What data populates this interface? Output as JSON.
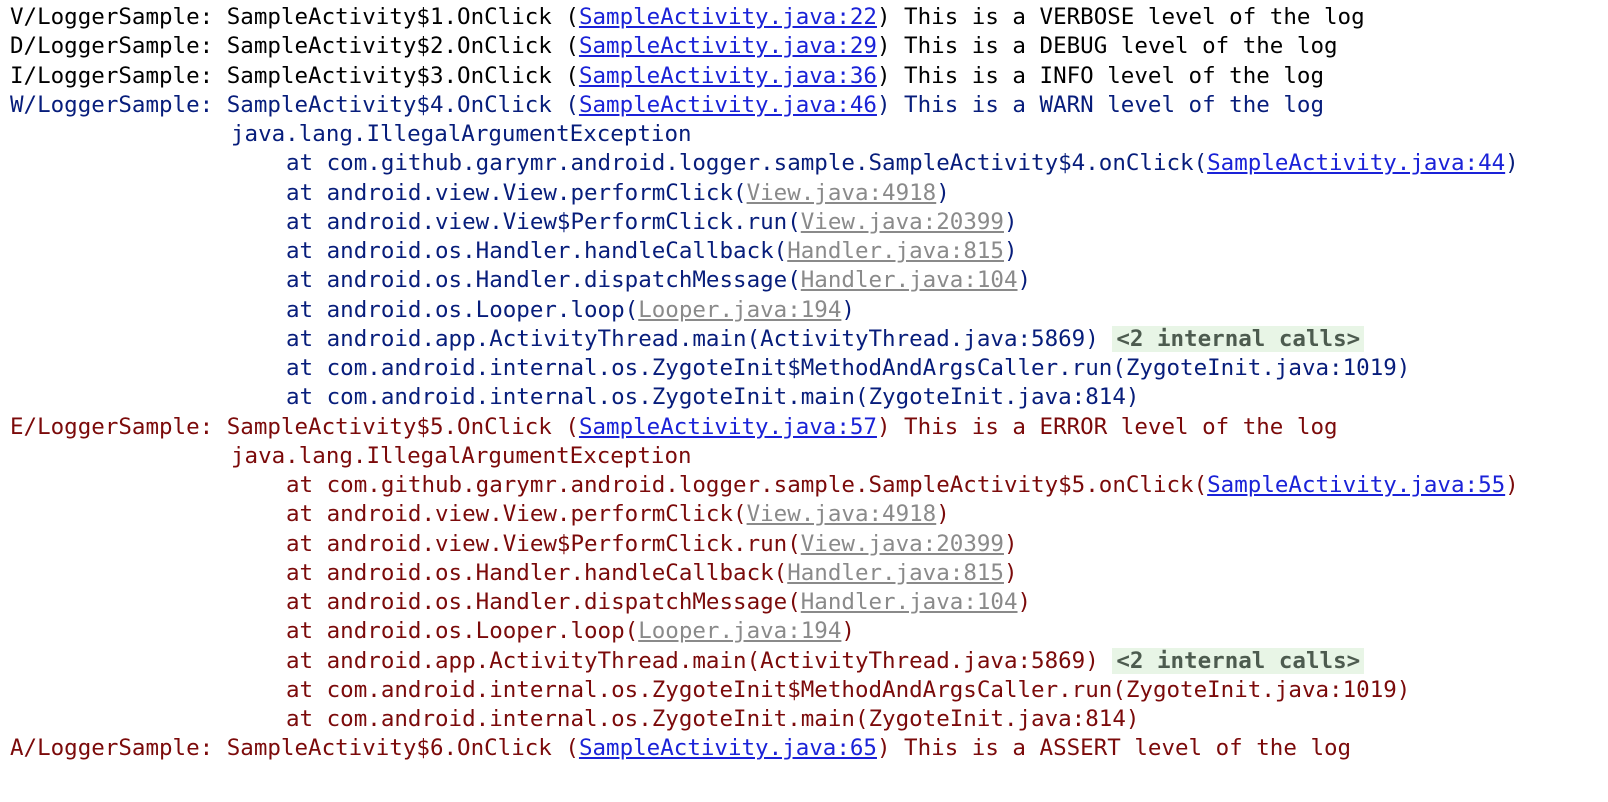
{
  "colors": {
    "default": "#000000",
    "warn": "#071d7b",
    "error": "#7b0a0a",
    "source_link": "#1a22d8",
    "library_link": "#8a8a8a",
    "fold_bg": "#e8f5e6"
  },
  "lines": [
    {
      "type": "log",
      "level": "V",
      "tag": "V/LoggerSample: ",
      "method": "SampleActivity$1.OnClick (",
      "link": "SampleActivity.java:22",
      "message": ") This is a VERBOSE level of the log"
    },
    {
      "type": "log",
      "level": "D",
      "tag": "D/LoggerSample: ",
      "method": "SampleActivity$2.OnClick (",
      "link": "SampleActivity.java:29",
      "message": ") This is a DEBUG level of the log"
    },
    {
      "type": "log",
      "level": "I",
      "tag": "I/LoggerSample: ",
      "method": "SampleActivity$3.OnClick (",
      "link": "SampleActivity.java:36",
      "message": ") This is a INFO level of the log"
    },
    {
      "type": "log",
      "level": "W",
      "tag": "W/LoggerSample: ",
      "method": "SampleActivity$4.OnClick (",
      "link": "SampleActivity.java:46",
      "message": ") This is a WARN level of the log"
    },
    {
      "type": "exception",
      "level": "W",
      "text": "java.lang.IllegalArgumentException"
    },
    {
      "type": "frame",
      "level": "W",
      "prefix": "at com.github.garymr.android.logger.sample.SampleActivity$4.onClick(",
      "link": "SampleActivity.java:44",
      "link_kind": "src",
      "suffix": ")"
    },
    {
      "type": "frame",
      "level": "W",
      "prefix": "at android.view.View.performClick(",
      "link": "View.java:4918",
      "link_kind": "lib",
      "suffix": ")"
    },
    {
      "type": "frame",
      "level": "W",
      "prefix": "at android.view.View$PerformClick.run(",
      "link": "View.java:20399",
      "link_kind": "lib",
      "suffix": ")"
    },
    {
      "type": "frame",
      "level": "W",
      "prefix": "at android.os.Handler.handleCallback(",
      "link": "Handler.java:815",
      "link_kind": "lib",
      "suffix": ")"
    },
    {
      "type": "frame",
      "level": "W",
      "prefix": "at android.os.Handler.dispatchMessage(",
      "link": "Handler.java:104",
      "link_kind": "lib",
      "suffix": ")"
    },
    {
      "type": "frame",
      "level": "W",
      "prefix": "at android.os.Looper.loop(",
      "link": "Looper.java:194",
      "link_kind": "lib",
      "suffix": ")"
    },
    {
      "type": "frame",
      "level": "W",
      "prefix": "at android.app.ActivityThread.main(ActivityThread.java:5869)",
      "fold": "<2 internal calls>"
    },
    {
      "type": "frame",
      "level": "W",
      "prefix": "at com.android.internal.os.ZygoteInit$MethodAndArgsCaller.run(ZygoteInit.java:1019)"
    },
    {
      "type": "frame",
      "level": "W",
      "prefix": "at com.android.internal.os.ZygoteInit.main(ZygoteInit.java:814)"
    },
    {
      "type": "log",
      "level": "E",
      "tag": "E/LoggerSample: ",
      "method": "SampleActivity$5.OnClick (",
      "link": "SampleActivity.java:57",
      "message": ") This is a ERROR level of the log"
    },
    {
      "type": "exception",
      "level": "E",
      "text": "java.lang.IllegalArgumentException"
    },
    {
      "type": "frame",
      "level": "E",
      "prefix": "at com.github.garymr.android.logger.sample.SampleActivity$5.onClick(",
      "link": "SampleActivity.java:55",
      "link_kind": "src",
      "suffix": ")"
    },
    {
      "type": "frame",
      "level": "E",
      "prefix": "at android.view.View.performClick(",
      "link": "View.java:4918",
      "link_kind": "lib",
      "suffix": ")"
    },
    {
      "type": "frame",
      "level": "E",
      "prefix": "at android.view.View$PerformClick.run(",
      "link": "View.java:20399",
      "link_kind": "lib",
      "suffix": ")"
    },
    {
      "type": "frame",
      "level": "E",
      "prefix": "at android.os.Handler.handleCallback(",
      "link": "Handler.java:815",
      "link_kind": "lib",
      "suffix": ")"
    },
    {
      "type": "frame",
      "level": "E",
      "prefix": "at android.os.Handler.dispatchMessage(",
      "link": "Handler.java:104",
      "link_kind": "lib",
      "suffix": ")"
    },
    {
      "type": "frame",
      "level": "E",
      "prefix": "at android.os.Looper.loop(",
      "link": "Looper.java:194",
      "link_kind": "lib",
      "suffix": ")"
    },
    {
      "type": "frame",
      "level": "E",
      "prefix": "at android.app.ActivityThread.main(ActivityThread.java:5869)",
      "fold": "<2 internal calls>"
    },
    {
      "type": "frame",
      "level": "E",
      "prefix": "at com.android.internal.os.ZygoteInit$MethodAndArgsCaller.run(ZygoteInit.java:1019)"
    },
    {
      "type": "frame",
      "level": "E",
      "prefix": "at com.android.internal.os.ZygoteInit.main(ZygoteInit.java:814)"
    },
    {
      "type": "log",
      "level": "A",
      "tag": "A/LoggerSample: ",
      "method": "SampleActivity$6.OnClick (",
      "link": "SampleActivity.java:65",
      "message": ") This is a ASSERT level of the log"
    }
  ]
}
